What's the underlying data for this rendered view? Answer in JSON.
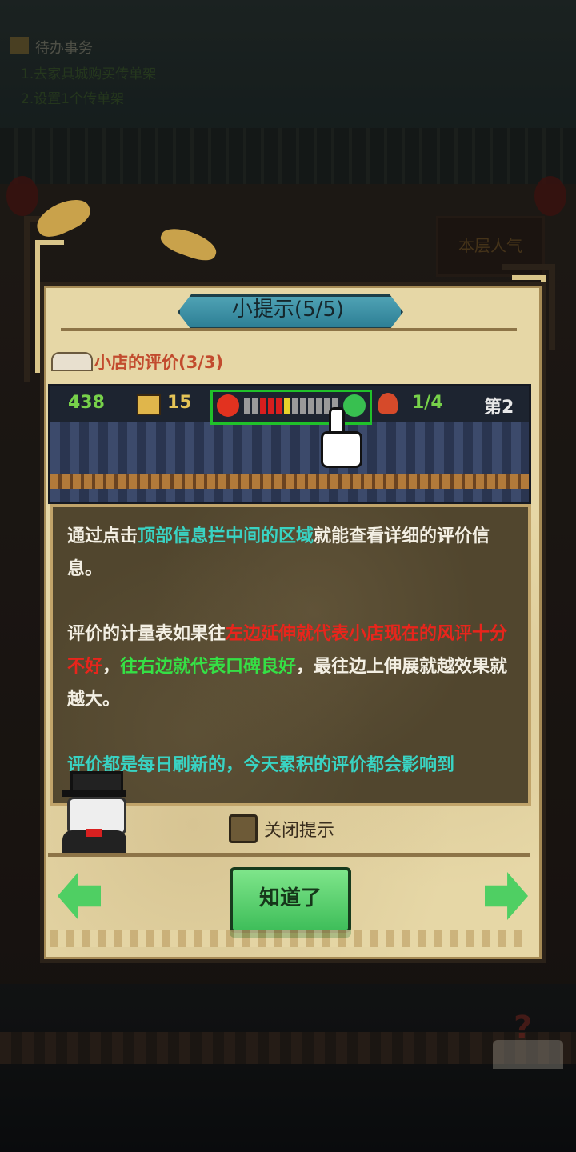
{
  "background": {
    "todo": {
      "title": "待办事务",
      "items": [
        "1.去家具城购买传单架",
        "2.设置1个传单架"
      ]
    },
    "popularity_sign": "本层人气"
  },
  "dialog": {
    "title": "小提示(5/5)",
    "subtitle": "小店的评价(3/3)",
    "preview": {
      "money": "438",
      "coins": "15",
      "guests": "1/4",
      "day": "第2",
      "meter_segments": [
        "#9a9a9a",
        "#9a9a9a",
        "#d81e1e",
        "#d81e1e",
        "#d81e1e",
        "#e6d12a",
        "#9a9a9a",
        "#9a9a9a",
        "#9a9a9a",
        "#9a9a9a",
        "#9a9a9a",
        "#9a9a9a"
      ]
    },
    "paragraph1": {
      "p1": "通过点击",
      "p2": "顶部信息拦中间的区域",
      "p3": "就能查看详细的评价信息。"
    },
    "paragraph2": {
      "p1": "评价的计量表如果往",
      "p2": "左边延伸就代表小店现在的风评十分不好",
      "p3": "，",
      "p4": "往右边就代表口碑良好",
      "p5": "，最往边上伸展就越效果就越大。"
    },
    "paragraph3": "评价都是每日刷新的，今天累积的评价都会影响到",
    "checkbox_label": "关闭提示",
    "ok_button": "知道了"
  },
  "colors": {
    "highlight_cyan": "#39d3c3",
    "highlight_red": "#e8251c",
    "highlight_green": "#35e045",
    "button_green": "#4fcf63"
  }
}
